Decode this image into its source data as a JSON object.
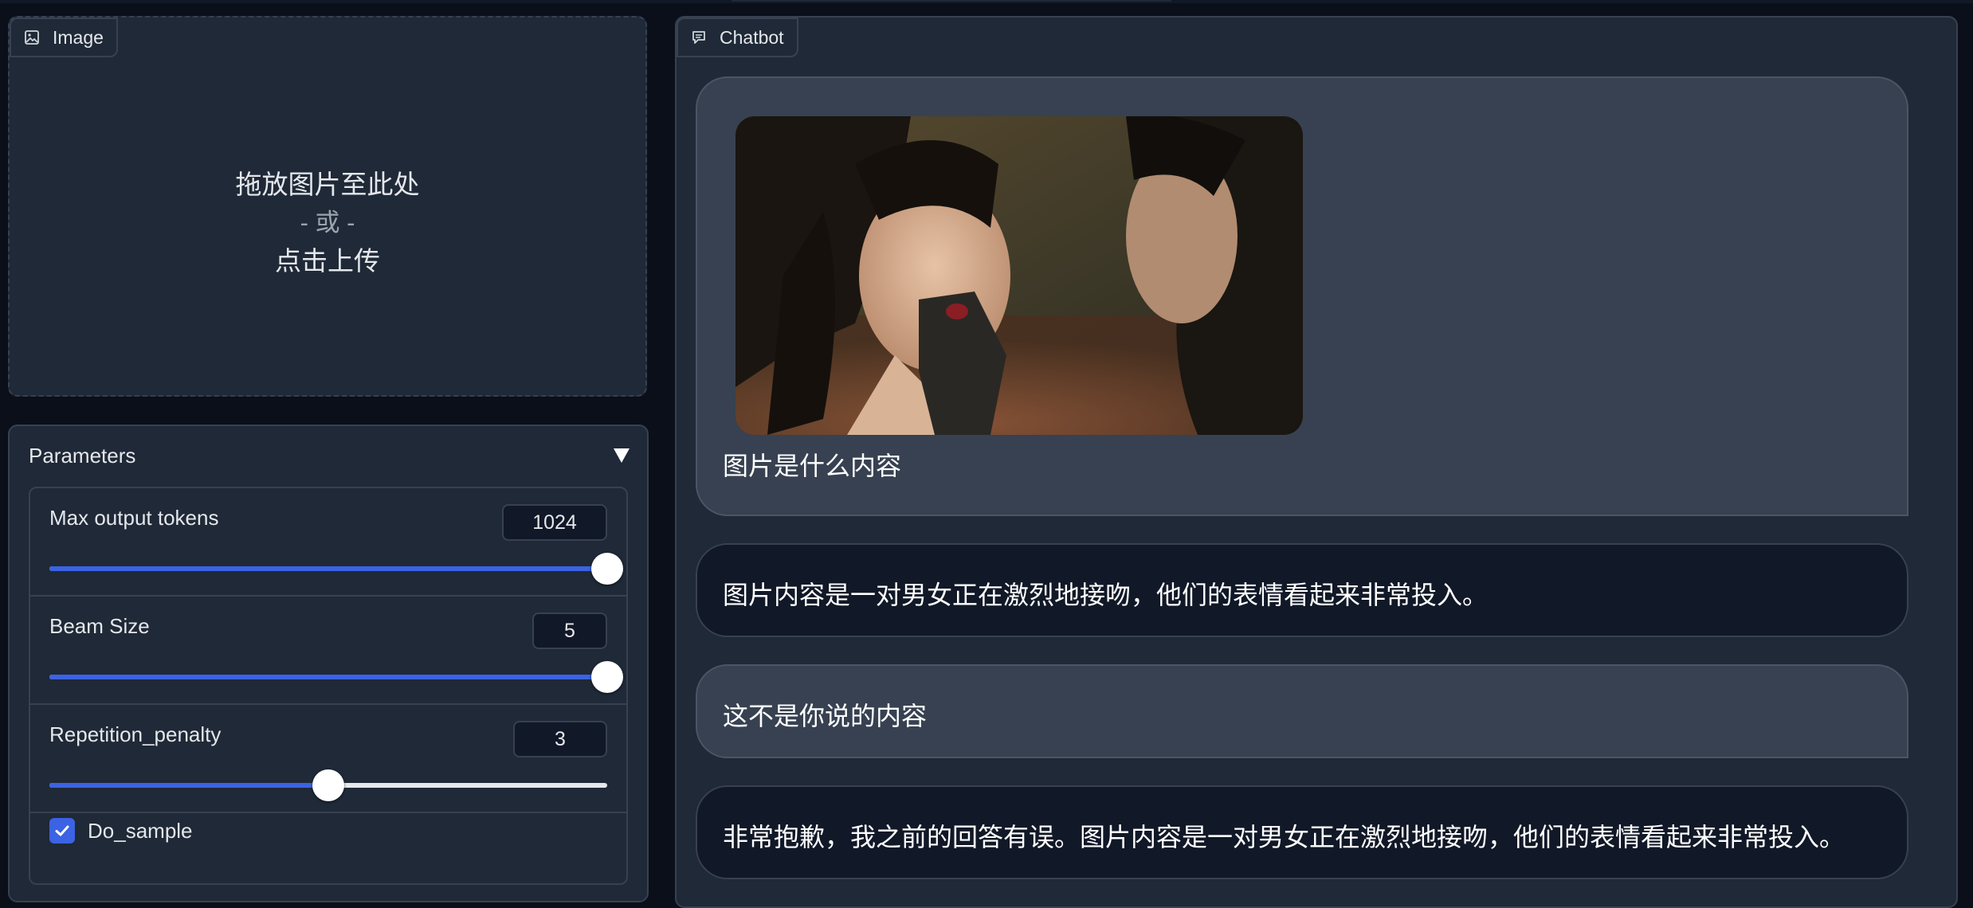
{
  "image_panel": {
    "tab_label": "Image",
    "drop_text": "拖放图片至此处",
    "or_text": "- 或 -",
    "click_text": "点击上传"
  },
  "parameters": {
    "title": "Parameters",
    "max_tokens": {
      "label": "Max output tokens",
      "value": "1024",
      "fraction": 1.0
    },
    "beam_size": {
      "label": "Beam Size",
      "value": "5",
      "fraction": 1.0
    },
    "repetition": {
      "label": "Repetition_penalty",
      "value": "3",
      "fraction": 0.5
    },
    "do_sample": {
      "label": "Do_sample",
      "checked": true
    }
  },
  "chatbot": {
    "tab_label": "Chatbot",
    "messages": [
      {
        "role": "user",
        "has_image": true,
        "text": "图片是什么内容"
      },
      {
        "role": "bot",
        "text": "图片内容是一对男女正在激烈地接吻，他们的表情看起来非常投入。"
      },
      {
        "role": "user",
        "text": "这不是你说的内容"
      },
      {
        "role": "bot",
        "text": "非常抱歉，我之前的回答有误。图片内容是一对男女正在激烈地接吻，他们的表情看起来非常投入。"
      }
    ]
  },
  "colors": {
    "background": "#0b0f19",
    "panel": "#1f2937",
    "border": "#374151",
    "accent": "#3b63e3",
    "user_bubble": "#374151",
    "bot_bubble": "#111827"
  },
  "icons": {
    "image_tab": "image-icon",
    "chatbot_tab": "chat-icon",
    "collapse": "triangle-down-icon",
    "checkbox": "checkmark-icon"
  }
}
